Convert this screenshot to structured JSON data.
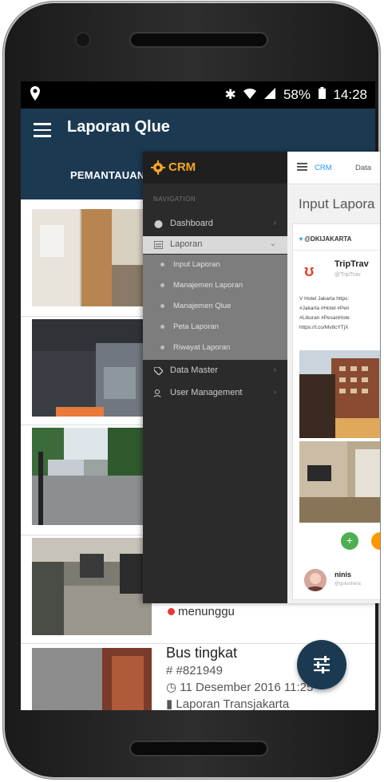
{
  "statusbar": {
    "location_icon": "location-pin-icon",
    "bluetooth": "✱",
    "battery_percent": "58%",
    "time": "14:28"
  },
  "appbar": {
    "title": "Laporan Qlue",
    "menu_icon": "hamburger-menu-icon"
  },
  "tabs": [
    {
      "label": "PEMANTAUAN"
    }
  ],
  "list": {
    "item4_status": "menunggu",
    "item5": {
      "title": "Bus tingkat",
      "id": "#821949",
      "date": "11 Desember 2016 11:25",
      "category": "Laporan Transjakarta"
    }
  },
  "fab": {
    "icon": "tune-filter-icon"
  },
  "crm": {
    "logo_text": "CRM",
    "nav_header": "NAVIGATION",
    "nav_items": [
      {
        "label": "Dashboard",
        "icon": "palette-icon"
      },
      {
        "label": "Laporan",
        "icon": "report-icon"
      },
      {
        "label": "Data Master",
        "icon": "tag-icon"
      },
      {
        "label": "User Management",
        "icon": "users-icon"
      }
    ],
    "sub_items": [
      {
        "label": "Input Laporan"
      },
      {
        "label": "Manajemen Laporan"
      },
      {
        "label": "Manajemen Qlue"
      },
      {
        "label": "Peta Laporan"
      },
      {
        "label": "Riwayat Laporan"
      }
    ],
    "topbar": {
      "crumb1": "CRM",
      "crumb2": "Data"
    },
    "page_title": "Input Lapora",
    "card": {
      "handle": "@DKIJAKARTA",
      "user": "TripTrav",
      "user_sub": "@TripTrav",
      "text_lines": [
        "V Hotel Jakarta https:",
        "#Jakarta #Hotel #Pen",
        "#Liburan #PesanHote",
        "https://t.co/Mv8cYTjX"
      ],
      "commenter": "ninis",
      "commenter_sub": "@gulunhera"
    }
  },
  "colors": {
    "primary": "#1b3a52",
    "crm_sidebar": "#2b2b2b",
    "crm_accent": "#f5a623",
    "status_red": "#e53935"
  }
}
